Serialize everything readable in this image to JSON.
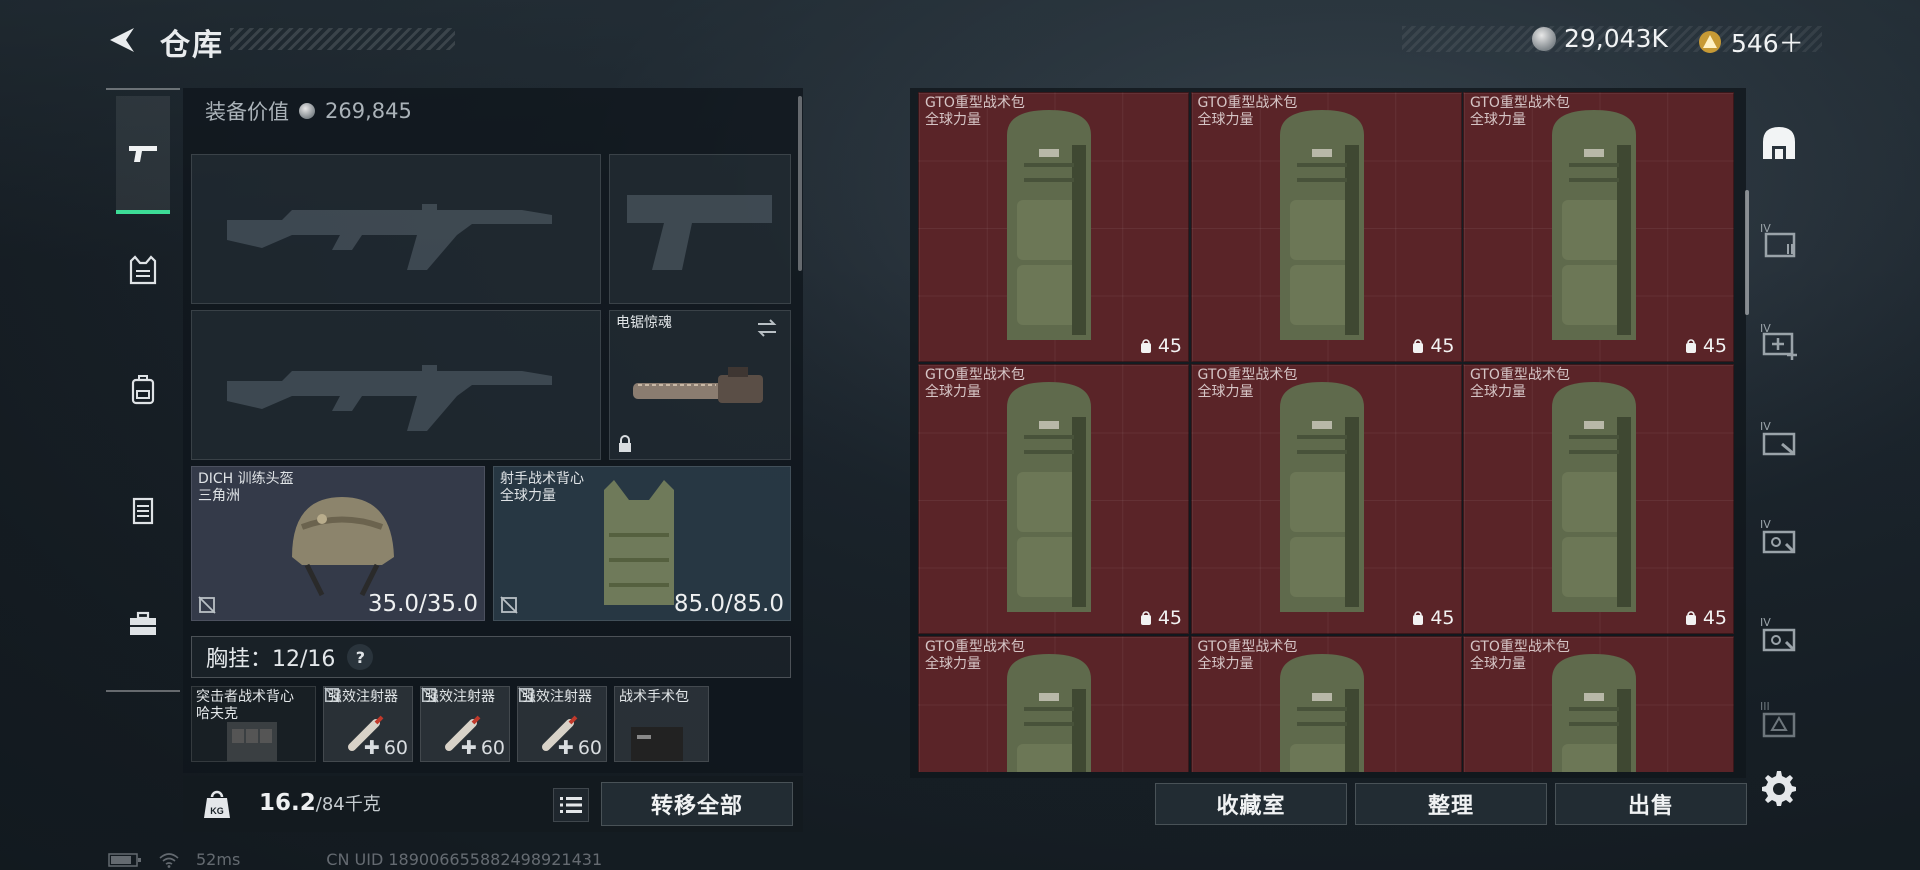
{
  "header": {
    "title": "仓库",
    "silver_amount": "29,043K",
    "gold_amount": "546＋"
  },
  "loadout": {
    "equip_value_label": "装备价值",
    "equip_value": "269,845",
    "weapon_slot_4_name": "电锯惊魂",
    "helmet": {
      "name": "DICH 训练头盔",
      "sub": "三角洲",
      "durability": "35.0/35.0"
    },
    "vest": {
      "name": "射手战术背心",
      "sub": "全球力量",
      "durability": "85.0/85.0"
    },
    "chest_label": "胸挂：12/16",
    "help": "?",
    "chest_rig": {
      "name": "突击者战术背心",
      "sub": "哈夫克"
    },
    "injectors": [
      {
        "name": "强效注射器",
        "count": "60"
      },
      {
        "name": "强效注射器",
        "count": "60"
      },
      {
        "name": "强效注射器",
        "count": "60"
      }
    ],
    "pouch": {
      "name": "战术手术包"
    }
  },
  "bottom_left": {
    "weight_current": "16.2",
    "weight_max": "/84千克",
    "transfer_all": "转移全部"
  },
  "stash": {
    "item_name": "GTO重型战术包",
    "item_sub": "全球力量",
    "item_capacity": "45",
    "vault_button": "收藏室",
    "sort_button": "整理",
    "sell_button": "出售"
  },
  "right_rail": {
    "tiers": [
      "IV",
      "IV",
      "IV",
      "IV",
      "IV",
      "III"
    ]
  },
  "status_bar": {
    "ping": "52ms",
    "uid": "CN UID 1890066558824989214​31"
  },
  "colors": {
    "accent": "#3ddc97",
    "stash_cell": "#5a2428",
    "panel": "#10161c"
  }
}
